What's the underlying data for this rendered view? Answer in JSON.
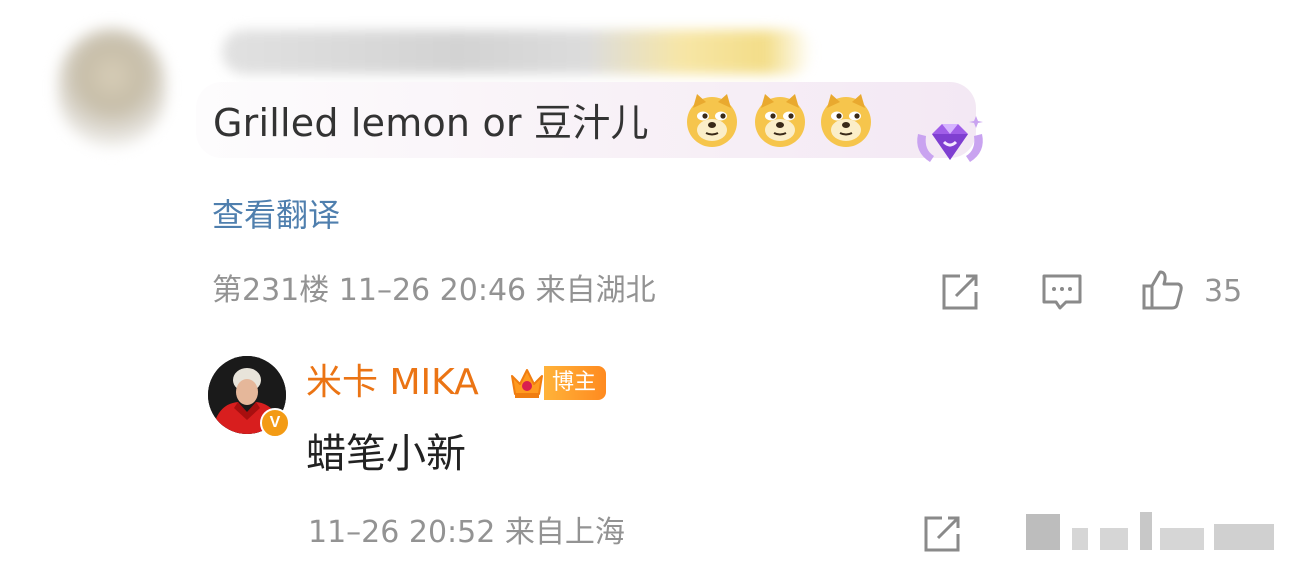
{
  "comment": {
    "text": "Grilled lemon or 豆汁儿",
    "emoji_icons": [
      "doge-icon",
      "doge-icon",
      "doge-icon"
    ],
    "badge_icon": "purple-gem-badge-icon",
    "translate_label": "查看翻译",
    "meta": "第231楼  11–26 20:46  来自湖北",
    "actions": [
      "share-icon",
      "comment-icon",
      "like-icon"
    ],
    "like_count": "35"
  },
  "reply": {
    "author_name": "米卡 MIKA",
    "author_tag": "博主",
    "author_badge_icon": "crown-icon",
    "verified_icon": "verified-v-icon",
    "verified_letter": "V",
    "text": "蜡笔小新",
    "meta": "11–26 20:52  来自上海",
    "actions": [
      "share-icon"
    ]
  },
  "colors": {
    "link": "#4f7fae",
    "meta": "#939393",
    "author": "#eb7414",
    "tag_bg": "#ff8a1f",
    "bubble": "#f3e8f4"
  }
}
